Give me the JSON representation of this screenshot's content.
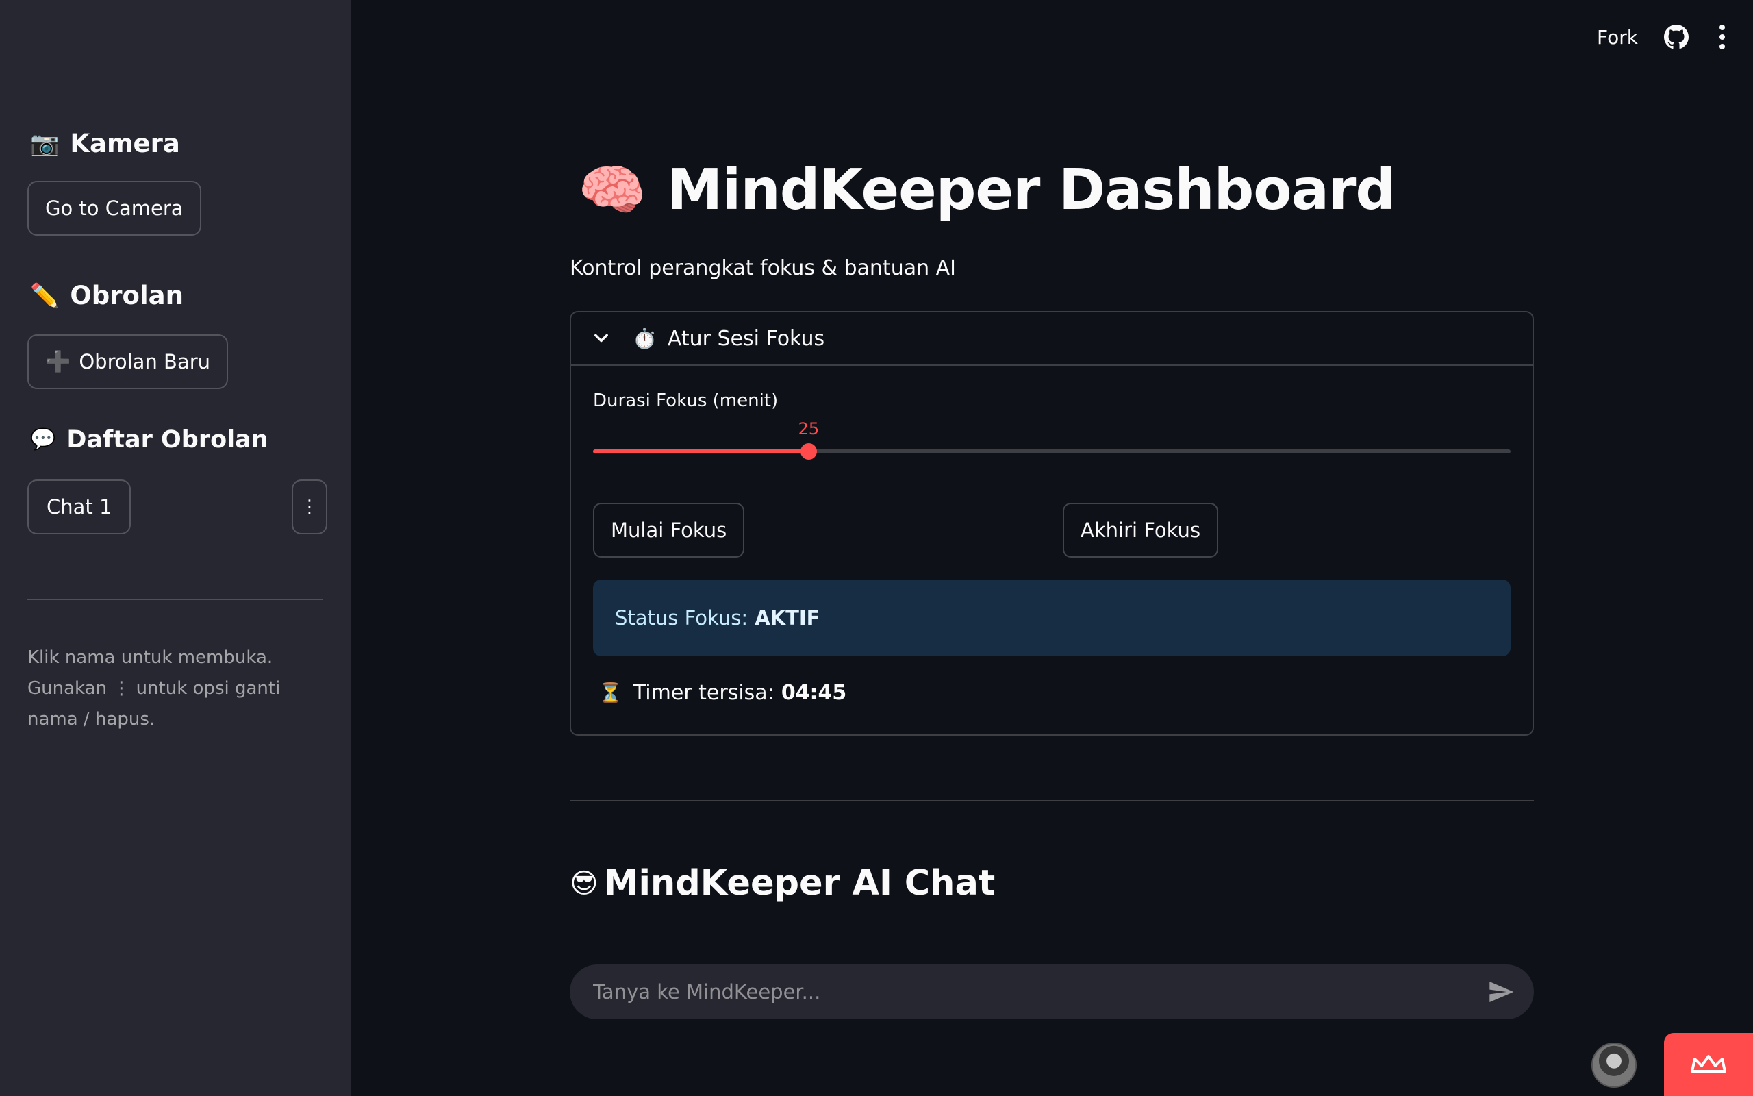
{
  "toolbar": {
    "fork_label": "Fork",
    "github_icon": "github-icon",
    "menu_icon": "kebab-menu-icon"
  },
  "sidebar": {
    "camera": {
      "icon": "📷",
      "heading": "Kamera",
      "button_label": "Go to Camera"
    },
    "chat": {
      "icon": "✏️",
      "heading": "Obrolan",
      "new_chat_icon": "➕",
      "new_chat_label": "Obrolan Baru"
    },
    "chat_list": {
      "icon": "💬",
      "heading": "Daftar Obrolan",
      "items": [
        {
          "label": "Chat 1",
          "options_icon": "⋮"
        }
      ]
    },
    "caption_line1": "Klik nama untuk membuka.",
    "caption_line2": "Gunakan ⋮ untuk opsi ganti nama / hapus."
  },
  "main": {
    "title_icon": "🧠",
    "title": "MindKeeper Dashboard",
    "subtitle": "Kontrol perangkat fokus & bantuan AI",
    "focus_session": {
      "icon": "⏱️",
      "expander_title": "Atur Sesi Fokus",
      "slider_label": "Durasi Fokus (menit)",
      "slider_value": "25",
      "slider_fraction": 0.235,
      "start_button": "Mulai Fokus",
      "end_button": "Akhiri Fokus",
      "status_label": "Status Fokus:",
      "status_value": "AKTIF",
      "timer_icon": "⏳",
      "timer_label": "Timer tersisa:",
      "timer_value": "04:45"
    },
    "chat_section": {
      "icon": "😎",
      "title": "MindKeeper AI Chat",
      "input_placeholder": "Tanya ke MindKeeper...",
      "input_value": ""
    }
  },
  "colors": {
    "background": "#0e1117",
    "sidebar": "#262730",
    "accent": "#ff4b4b",
    "info_bg": "#172d43",
    "info_text": "#c7ebff"
  }
}
